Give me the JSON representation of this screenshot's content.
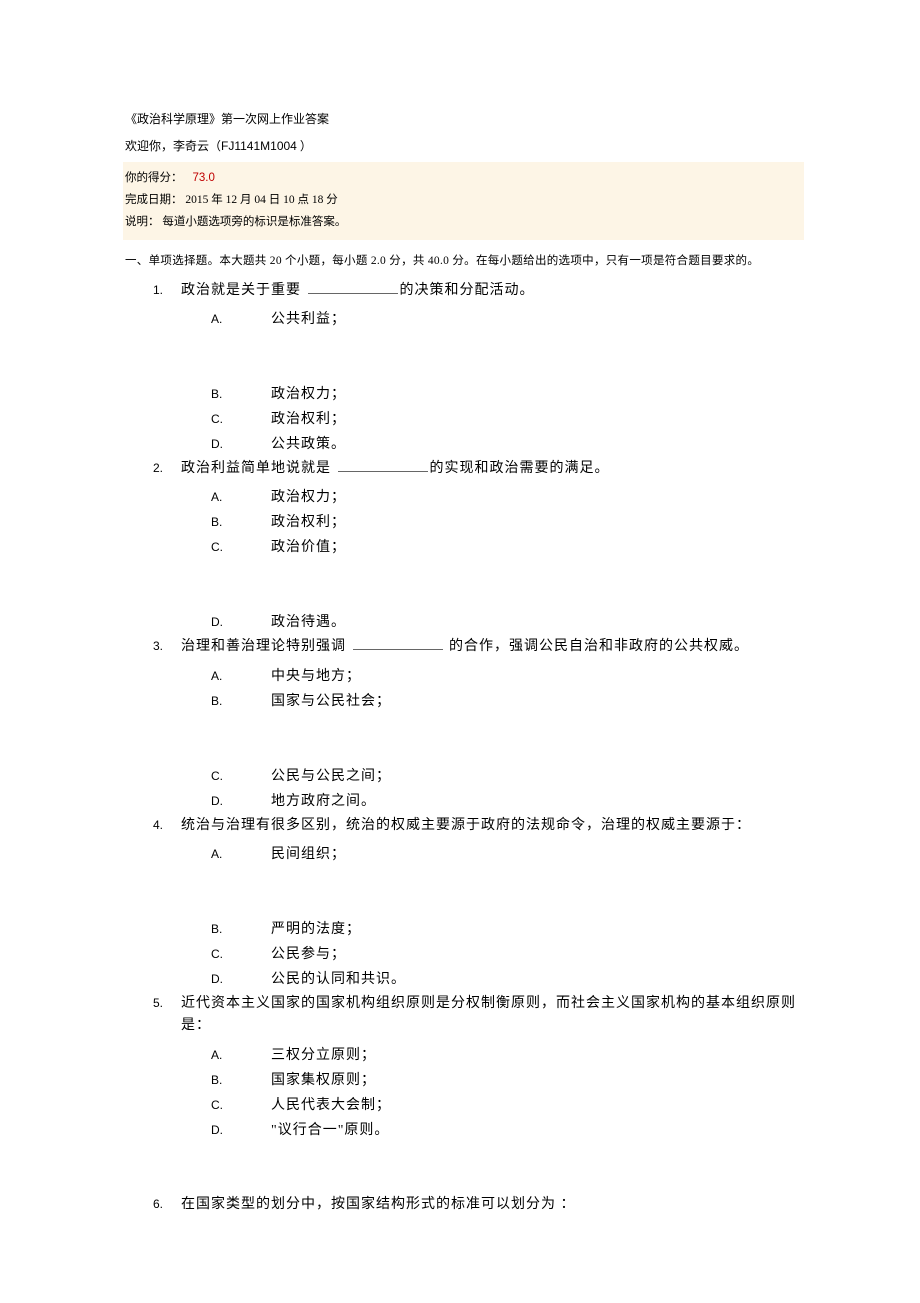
{
  "doc_title": "《政治科学原理》第一次网上作业答案",
  "welcome_prefix": "欢迎你，李奇云（",
  "welcome_id": "FJ1141M1004",
  "welcome_suffix": "  ）",
  "info": {
    "score_label": "你的得分：",
    "score_value": "73.0",
    "date_line": "完成日期：  2015  年 12 月 04 日 10 点 18 分",
    "note_line": "说明：   每道小题选项旁的标识是标准答案。"
  },
  "section_intro": "一、单项选择题。本大题共   20 个小题，每小题   2.0  分，共 40.0  分。在每小题给出的选项中，只有一项是符合题目要求的。",
  "questions": [
    {
      "num": "1.",
      "text_a": "政治就是关于重要   ",
      "blank": true,
      "text_b": "的决策和分配活动。",
      "options": [
        {
          "letter": "A.",
          "text": "公共利益；",
          "gap_after": true
        },
        {
          "letter": "B.",
          "text": "政治权力；"
        },
        {
          "letter": "C.",
          "text": "政治权利；"
        },
        {
          "letter": "D.",
          "text": "公共政策。"
        }
      ]
    },
    {
      "num": "2.",
      "text_a": "政治利益简单地说就是   ",
      "blank": true,
      "text_b": "的实现和政治需要的满足。",
      "options": [
        {
          "letter": "A.",
          "text": "政治权力；"
        },
        {
          "letter": "B.",
          "text": "政治权利；"
        },
        {
          "letter": "C.",
          "text": "政治价值；",
          "gap_after": true
        },
        {
          "letter": "D.",
          "text": "政治待遇。"
        }
      ]
    },
    {
      "num": "3.",
      "text_a": "治理和善治理论特别强调   ",
      "blank": true,
      "text_b": " 的合作，强调公民自治和非政府的公共权威。",
      "options": [
        {
          "letter": "A.",
          "text": "中央与地方；"
        },
        {
          "letter": "B.",
          "text": "国家与公民社会；",
          "gap_after": true
        },
        {
          "letter": "C.",
          "text": "公民与公民之间；"
        },
        {
          "letter": "D.",
          "text": "地方政府之间。"
        }
      ]
    },
    {
      "num": "4.",
      "text_a": "统治与治理有很多区别，统治的权威主要源于政府的法规命令，治理的权威主要源于：",
      "blank": false,
      "text_b": "",
      "options": [
        {
          "letter": "A.",
          "text": "民间组织；",
          "gap_after": true
        },
        {
          "letter": "B.",
          "text": "严明的法度；"
        },
        {
          "letter": "C.",
          "text": "公民参与；"
        },
        {
          "letter": "D.",
          "text": "公民的认同和共识。"
        }
      ]
    },
    {
      "num": "5.",
      "text_a": "近代资本主义国家的国家机构组织原则是分权制衡原则，而社会主义国家机构的基本组织原则是：",
      "blank": false,
      "text_b": "",
      "options": [
        {
          "letter": "A.",
          "text": "三权分立原则；"
        },
        {
          "letter": "B.",
          "text": "国家集权原则；"
        },
        {
          "letter": "C.",
          "text": "人民代表大会制；"
        },
        {
          "letter": "D.",
          "text": "\"议行合一\"原则。",
          "gap_after": true
        }
      ]
    },
    {
      "num": "6.",
      "text_a": "在国家类型的划分中，按国家结构形式的标准可以划分为        ：",
      "blank": false,
      "text_b": "",
      "options": []
    }
  ]
}
